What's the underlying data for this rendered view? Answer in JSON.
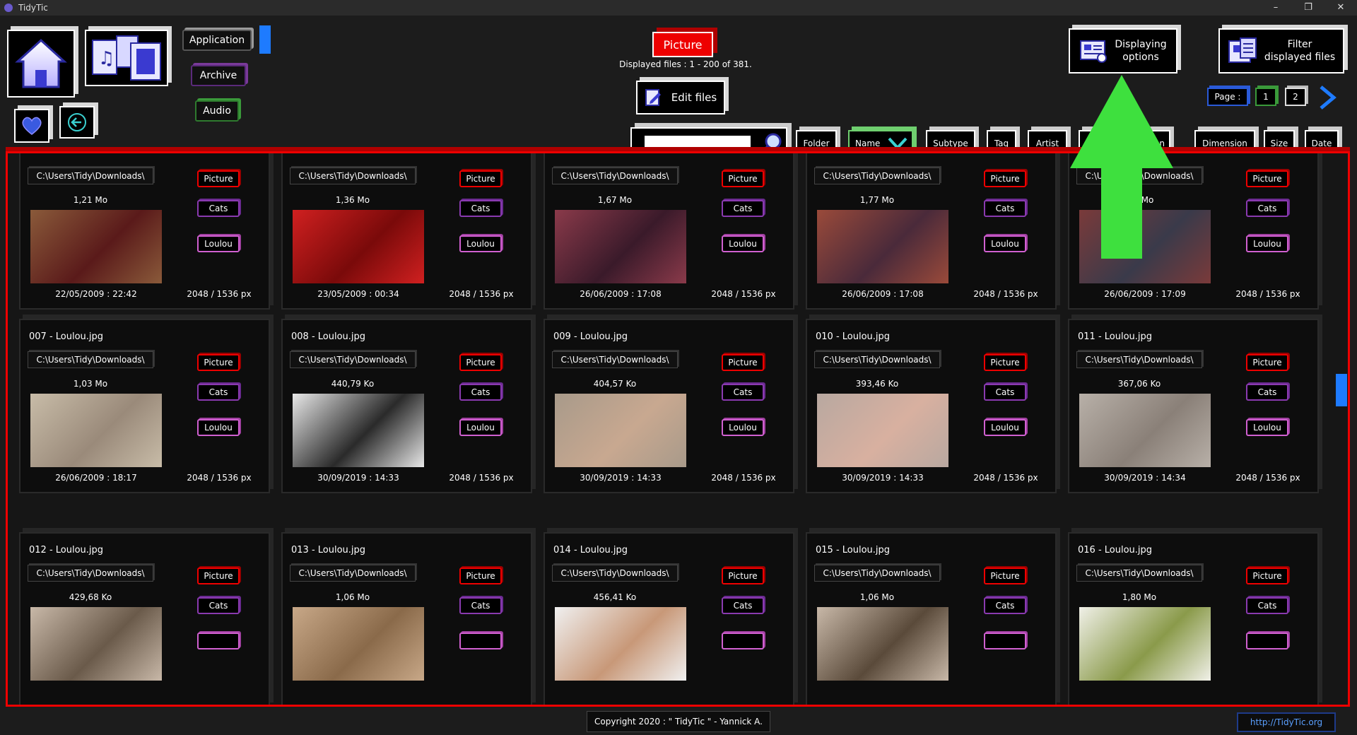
{
  "window": {
    "title": "TidyTic",
    "controls": [
      "–",
      "❐",
      "✕"
    ]
  },
  "nav": {
    "categories": [
      "Application",
      "Archive",
      "Audio"
    ]
  },
  "type_button": "Picture",
  "displayed_files": "Displayed files : 1 - 200 of 381.",
  "edit_files": "Edit files",
  "displaying_options": [
    "Displaying",
    "options"
  ],
  "filter_files": [
    "Filter",
    "displayed files"
  ],
  "pagination": {
    "label": "Page :",
    "pages": [
      "1",
      "2"
    ]
  },
  "search": {
    "value": "",
    "placeholder": ""
  },
  "sort_buttons": [
    "Folder",
    "Name",
    "Subtype",
    "Tag",
    "Artist",
    "ion",
    "Dimension",
    "Size",
    "Date"
  ],
  "files": [
    {
      "name": "",
      "path": "C:\\Users\\Tidy\\Downloads\\",
      "size": "1,21 Mo",
      "date": "22/05/2009 : 22:42",
      "dim": "2048 / 1536 px",
      "tags": [
        "Picture",
        "Cats",
        "Loulou"
      ],
      "c1": "#8a5a3a",
      "c2": "#5a1a1a"
    },
    {
      "name": "",
      "path": "C:\\Users\\Tidy\\Downloads\\",
      "size": "1,36 Mo",
      "date": "23/05/2009 : 00:34",
      "dim": "2048 / 1536 px",
      "tags": [
        "Picture",
        "Cats",
        "Loulou"
      ],
      "c1": "#d02020",
      "c2": "#7a0a0a"
    },
    {
      "name": "",
      "path": "C:\\Users\\Tidy\\Downloads\\",
      "size": "1,67 Mo",
      "date": "26/06/2009 : 17:08",
      "dim": "2048 / 1536 px",
      "tags": [
        "Picture",
        "Cats",
        "Loulou"
      ],
      "c1": "#8a3a4a",
      "c2": "#3a1a2a"
    },
    {
      "name": "",
      "path": "C:\\Users\\Tidy\\Downloads\\",
      "size": "1,77 Mo",
      "date": "26/06/2009 : 17:08",
      "dim": "2048 / 1536 px",
      "tags": [
        "Picture",
        "Cats",
        "Loulou"
      ],
      "c1": "#9a4a3a",
      "c2": "#4a2a3a"
    },
    {
      "name": "",
      "path": "C:\\Users\\Tidy\\Downloads\\",
      "size": "1,7 Mo",
      "date": "26/06/2009 : 17:09",
      "dim": "2048 / 1536 px",
      "tags": [
        "Picture",
        "Cats",
        "Loulou"
      ],
      "c1": "#7a3a3a",
      "c2": "#3a3a4a"
    },
    {
      "name": "007 - Loulou.jpg",
      "path": "C:\\Users\\Tidy\\Downloads\\",
      "size": "1,03 Mo",
      "date": "26/06/2009 : 18:17",
      "dim": "2048 / 1536 px",
      "tags": [
        "Picture",
        "Cats",
        "Loulou"
      ],
      "c1": "#c8bca8",
      "c2": "#9a8a7a"
    },
    {
      "name": "008 - Loulou.jpg",
      "path": "C:\\Users\\Tidy\\Downloads\\",
      "size": "440,79 Ko",
      "date": "30/09/2019 : 14:33",
      "dim": "2048 / 1536 px",
      "tags": [
        "Picture",
        "Cats",
        "Loulou"
      ],
      "c1": "#e8e8e8",
      "c2": "#2a2a2a"
    },
    {
      "name": "009 - Loulou.jpg",
      "path": "C:\\Users\\Tidy\\Downloads\\",
      "size": "404,57 Ko",
      "date": "30/09/2019 : 14:33",
      "dim": "2048 / 1536 px",
      "tags": [
        "Picture",
        "Cats",
        "Loulou"
      ],
      "c1": "#a89a8a",
      "c2": "#c8a890"
    },
    {
      "name": "010 - Loulou.jpg",
      "path": "C:\\Users\\Tidy\\Downloads\\",
      "size": "393,46 Ko",
      "date": "30/09/2019 : 14:33",
      "dim": "2048 / 1536 px",
      "tags": [
        "Picture",
        "Cats",
        "Loulou"
      ],
      "c1": "#b8a8a0",
      "c2": "#d8b0a0"
    },
    {
      "name": "011 - Loulou.jpg",
      "path": "C:\\Users\\Tidy\\Downloads\\",
      "size": "367,06 Ko",
      "date": "30/09/2019 : 14:34",
      "dim": "2048 / 1536 px",
      "tags": [
        "Picture",
        "Cats",
        "Loulou"
      ],
      "c1": "#b8b0a8",
      "c2": "#8a8078"
    },
    {
      "name": "012 - Loulou.jpg",
      "path": "C:\\Users\\Tidy\\Downloads\\",
      "size": "429,68 Ko",
      "date": "",
      "dim": "",
      "tags": [
        "Picture",
        "Cats",
        ""
      ],
      "c1": "#c8b8a8",
      "c2": "#6a5a4a"
    },
    {
      "name": "013 - Loulou.jpg",
      "path": "C:\\Users\\Tidy\\Downloads\\",
      "size": "1,06 Mo",
      "date": "",
      "dim": "",
      "tags": [
        "Picture",
        "Cats",
        ""
      ],
      "c1": "#c8a888",
      "c2": "#8a6a4a"
    },
    {
      "name": "014 - Loulou.jpg",
      "path": "C:\\Users\\Tidy\\Downloads\\",
      "size": "456,41 Ko",
      "date": "",
      "dim": "",
      "tags": [
        "Picture",
        "Cats",
        ""
      ],
      "c1": "#f0f0f0",
      "c2": "#c89878"
    },
    {
      "name": "015 - Loulou.jpg",
      "path": "C:\\Users\\Tidy\\Downloads\\",
      "size": "1,06 Mo",
      "date": "",
      "dim": "",
      "tags": [
        "Picture",
        "Cats",
        ""
      ],
      "c1": "#c8b8a8",
      "c2": "#5a4a3a"
    },
    {
      "name": "016 - Loulou.jpg",
      "path": "C:\\Users\\Tidy\\Downloads\\",
      "size": "1,80 Mo",
      "date": "",
      "dim": "",
      "tags": [
        "Picture",
        "Cats",
        ""
      ],
      "c1": "#f0f0e8",
      "c2": "#8a9a4a"
    }
  ],
  "footer": {
    "copyright": "Copyright 2020 : \" TidyTic \" - Yannick A.",
    "link": "http://TidyTic.org"
  },
  "colors": {
    "accent_red": "#ee0000",
    "accent_blue": "#1e7bff",
    "arrow_green": "#3ee03e"
  }
}
